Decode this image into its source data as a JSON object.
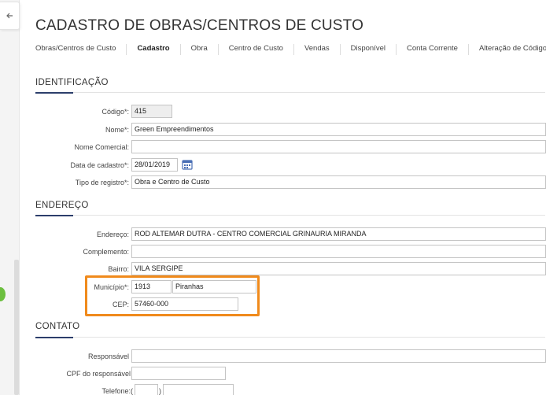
{
  "page": {
    "title": "CADASTRO DE OBRAS/CENTROS DE CUSTO"
  },
  "tabs": [
    {
      "label": "Obras/Centros de Custo",
      "active": false
    },
    {
      "label": "Cadastro",
      "active": true
    },
    {
      "label": "Obra",
      "active": false
    },
    {
      "label": "Centro de Custo",
      "active": false
    },
    {
      "label": "Vendas",
      "active": false
    },
    {
      "label": "Disponível",
      "active": false
    },
    {
      "label": "Conta Corrente",
      "active": false
    },
    {
      "label": "Alteração de Código",
      "active": false
    }
  ],
  "identificacao": {
    "title": "IDENTIFICAÇÃO",
    "codigo": {
      "label": "Código*:",
      "value": "415"
    },
    "nome": {
      "label": "Nome*:",
      "value": "Green Empreendimentos"
    },
    "nome_comercial": {
      "label": "Nome Comercial:",
      "value": ""
    },
    "data_cadastro": {
      "label": "Data de cadastro*:",
      "value": "28/01/2019"
    },
    "tipo_registro": {
      "label": "Tipo de registro*:",
      "value": "Obra e Centro de Custo"
    }
  },
  "endereco": {
    "title": "ENDEREÇO",
    "endereco": {
      "label": "Endereço:",
      "value": "ROD ALTEMAR DUTRA - CENTRO COMERCIAL GRINAURIA MIRANDA"
    },
    "complemento": {
      "label": "Complemento:",
      "value": ""
    },
    "bairro": {
      "label": "Bairro:",
      "value": "VILA SERGIPE"
    },
    "municipio": {
      "label": "Município*:",
      "code": "1913",
      "name": "Piranhas"
    },
    "cep": {
      "label": "CEP:",
      "value": "57460-000"
    }
  },
  "contato": {
    "title": "CONTATO",
    "responsavel": {
      "label": "Responsável",
      "value": ""
    },
    "cpf_responsavel": {
      "label": "CPF do responsável",
      "value": ""
    },
    "telefone": {
      "label": "Telefone:",
      "open_paren": "(",
      "close_paren": ")",
      "ddd": "",
      "number": ""
    }
  },
  "colors": {
    "accent": "#2c3e6b",
    "highlight": "#f08a1c",
    "status": "#6cbf3f"
  }
}
